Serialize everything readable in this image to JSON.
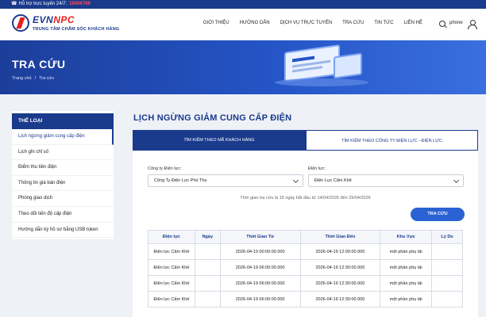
{
  "topbar": {
    "label": "Hỗ trợ trực tuyến 24/7:",
    "hotline": "19006769"
  },
  "logo": {
    "name_a": "EVN",
    "name_b": "NPC",
    "subtitle": "TRUNG TÂM CHĂM SÓC KHÁCH HÀNG"
  },
  "nav": [
    "GIỚI THIỆU",
    "HƯỚNG DẪN",
    "DỊCH VỤ TRỰC TUYẾN",
    "TRA CỨU",
    "TIN TỨC",
    "LIÊN HỆ"
  ],
  "header": {
    "phone_text": "phone"
  },
  "banner": {
    "title": "TRA CỨU",
    "breadcrumb_home": "Trang chủ",
    "breadcrumb_sep": "/",
    "breadcrumb_current": "Tra cứu"
  },
  "sidebar": {
    "heading": "THỂ LOẠI",
    "items": [
      "Lịch ngừng giảm cung cấp điện",
      "Lịch ghi chỉ số",
      "Điểm thu tiền điện",
      "Thông tin giá bán điện",
      "Phòng giao dịch",
      "Theo dõi tiến độ cấp điện",
      "Hướng dẫn ký hồ sơ bằng USB token"
    ]
  },
  "main": {
    "title": "LỊCH NGỪNG GIẢM CUNG CẤP ĐIỆN",
    "tab1": "TÌM KIẾM THEO MÃ KHÁCH HÀNG",
    "tab2": "TÌM KIẾM THEO CÔNG TY ĐIỆN LỰC - ĐIỆN LỰC",
    "company_label": "Công ty Điện lực:",
    "company_value": "Công Ty Điện Lực Phú Thọ",
    "branch_label": "Điện lực:",
    "branch_value": "Điện Lực Cẩm Khê",
    "info": "Thời gian tra cứu là 15 ngày bắt đầu từ 14/04/2026 đến 29/04/2026",
    "search_button": "TRA CỨU"
  },
  "table": {
    "headers": [
      "Điện lực",
      "Ngày",
      "Thời Gian Từ",
      "Thời Gian Đến",
      "Khu Vực",
      "Lý Do"
    ],
    "rows": [
      [
        "Điện lực Cẩm Khê",
        "",
        "2026-04-19 00:00:00.000",
        "2026-04-19 12:00:00.000",
        "một phần phụ tải",
        ""
      ],
      [
        "Điện lực Cẩm Khê",
        "",
        "2026-04-19 06:00:00.000",
        "2026-04-19 12:30:00.000",
        "một phần phụ tải",
        ""
      ],
      [
        "Điện lực Cẩm Khê",
        "",
        "2026-04-19 06:00:00.000",
        "2026-04-19 12:30:00.000",
        "một phần phụ tải",
        ""
      ],
      [
        "Điện lực Cẩm Khê",
        "",
        "2026-04-19 06:00:00.000",
        "2026-04-19 12:30:00.000",
        "một phần phụ tải",
        ""
      ]
    ]
  }
}
